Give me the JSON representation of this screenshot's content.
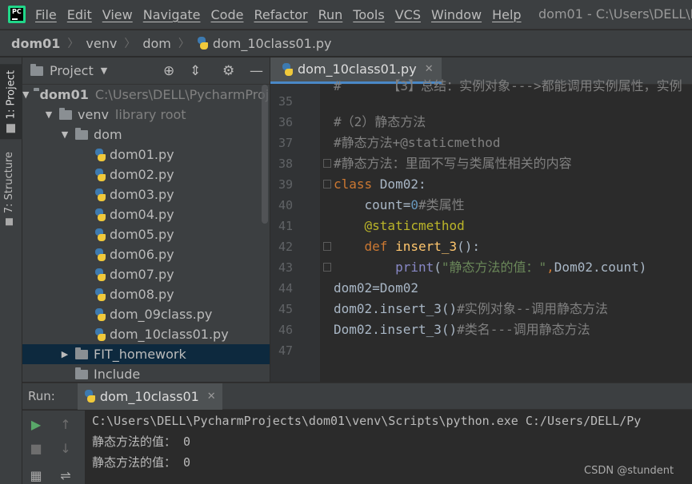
{
  "menubar": {
    "logo_text": "PC",
    "items": [
      "File",
      "Edit",
      "View",
      "Navigate",
      "Code",
      "Refactor",
      "Run",
      "Tools",
      "VCS",
      "Window",
      "Help"
    ],
    "window_title": "dom01 - C:\\Users\\DELL\\Pych"
  },
  "breadcrumb": {
    "items": [
      "dom01",
      "venv",
      "dom",
      "dom_10class01.py"
    ]
  },
  "left_strip": {
    "tabs": [
      "1: Project",
      "7: Structure"
    ]
  },
  "project_panel": {
    "title": "Project",
    "tree": [
      {
        "label": "dom01",
        "extra": "C:\\Users\\DELL\\PycharmProje",
        "type": "folder",
        "depth": 0,
        "open": true,
        "bold": true
      },
      {
        "label": "venv",
        "extra": "library root",
        "type": "folder",
        "depth": 1,
        "open": true
      },
      {
        "label": "dom",
        "extra": "",
        "type": "folder",
        "depth": 2,
        "open": true
      },
      {
        "label": "dom01.py",
        "type": "py",
        "depth": 3
      },
      {
        "label": "dom02.py",
        "type": "py",
        "depth": 3
      },
      {
        "label": "dom03.py",
        "type": "py",
        "depth": 3
      },
      {
        "label": "dom04.py",
        "type": "py",
        "depth": 3
      },
      {
        "label": "dom05.py",
        "type": "py",
        "depth": 3
      },
      {
        "label": "dom06.py",
        "type": "py",
        "depth": 3
      },
      {
        "label": "dom07.py",
        "type": "py",
        "depth": 3
      },
      {
        "label": "dom08.py",
        "type": "py",
        "depth": 3
      },
      {
        "label": "dom_09class.py",
        "type": "py",
        "depth": 3
      },
      {
        "label": "dom_10class01.py",
        "type": "py",
        "depth": 3
      },
      {
        "label": "FIT_homework",
        "extra": "",
        "type": "folder",
        "depth": 2,
        "open": false,
        "selected": true
      },
      {
        "label": "Include",
        "extra": "",
        "type": "folder",
        "depth": 2,
        "open": null
      }
    ]
  },
  "editor": {
    "tab_label": "dom_10class01.py",
    "top_partial": "#      【3】总结：实例对象--->都能调用实例属性，实例",
    "lines": [
      {
        "n": "35",
        "fold": false,
        "spans": []
      },
      {
        "n": "36",
        "fold": false,
        "spans": [
          {
            "c": "c-comment",
            "t": "#（2）静态方法"
          }
        ]
      },
      {
        "n": "37",
        "fold": false,
        "spans": [
          {
            "c": "c-comment",
            "t": "#静态方法+@staticmethod"
          }
        ]
      },
      {
        "n": "38",
        "fold": true,
        "spans": [
          {
            "c": "c-comment",
            "t": "#静态方法：里面不写与类属性相关的内容"
          }
        ]
      },
      {
        "n": "39",
        "fold": true,
        "spans": [
          {
            "c": "c-kw",
            "t": "class "
          },
          {
            "c": "c-def",
            "t": "Dom02:"
          }
        ]
      },
      {
        "n": "40",
        "fold": false,
        "spans": [
          {
            "c": "c-def",
            "t": "    count="
          },
          {
            "c": "c-num",
            "t": "0"
          },
          {
            "c": "c-comment",
            "t": "#类属性"
          }
        ]
      },
      {
        "n": "41",
        "fold": false,
        "spans": [
          {
            "c": "c-dec",
            "t": "    @staticmethod"
          }
        ]
      },
      {
        "n": "42",
        "fold": true,
        "spans": [
          {
            "c": "c-kw",
            "t": "    def "
          },
          {
            "c": "c-fn",
            "t": "insert_3"
          },
          {
            "c": "c-def",
            "t": "():"
          }
        ]
      },
      {
        "n": "43",
        "fold": true,
        "spans": [
          {
            "c": "c-bi",
            "t": "        print"
          },
          {
            "c": "c-def",
            "t": "("
          },
          {
            "c": "c-str",
            "t": "\"静态方法的值：\""
          },
          {
            "c": "c-kw",
            "t": ","
          },
          {
            "c": "c-def",
            "t": "Dom02.count)"
          }
        ]
      },
      {
        "n": "44",
        "fold": false,
        "spans": [
          {
            "c": "c-def",
            "t": "dom02=Dom02"
          }
        ]
      },
      {
        "n": "45",
        "fold": false,
        "spans": [
          {
            "c": "c-def",
            "t": "dom02.insert_3()"
          },
          {
            "c": "c-comment",
            "t": "#实例对象--调用静态方法"
          }
        ]
      },
      {
        "n": "46",
        "fold": false,
        "spans": [
          {
            "c": "c-def",
            "t": "Dom02.insert_3()"
          },
          {
            "c": "c-comment",
            "t": "#类名---调用静态方法"
          }
        ]
      },
      {
        "n": "47",
        "fold": false,
        "spans": []
      }
    ]
  },
  "run_panel": {
    "label": "Run:",
    "tab_label": "dom_10class01",
    "output": [
      "C:\\Users\\DELL\\PycharmProjects\\dom01\\venv\\Scripts\\python.exe C:/Users/DELL/Py",
      "静态方法的值： 0",
      "静态方法的值： 0"
    ]
  },
  "watermark": "CSDN @stundent"
}
